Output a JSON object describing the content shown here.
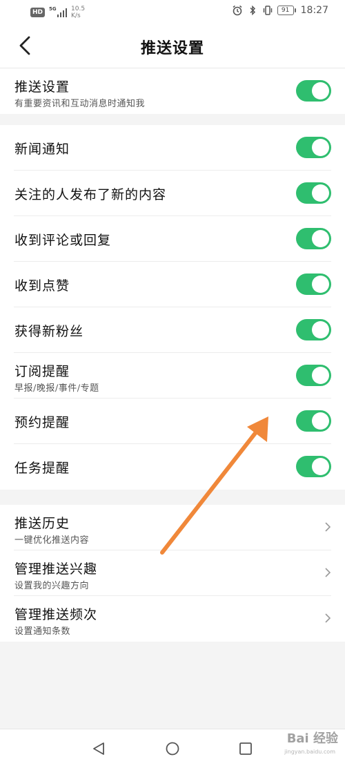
{
  "status_bar": {
    "hd_badge": "HD",
    "network": "5G",
    "net_speed_value": "10.5",
    "net_speed_unit": "K/s",
    "battery": "91",
    "time": "18:27"
  },
  "header": {
    "title": "推送设置"
  },
  "master": {
    "label": "推送设置",
    "sub": "有重要资讯和互动消息时通知我",
    "enabled": true
  },
  "notifications": [
    {
      "label": "新闻通知",
      "enabled": true
    },
    {
      "label": "关注的人发布了新的内容",
      "enabled": true
    },
    {
      "label": "收到评论或回复",
      "enabled": true
    },
    {
      "label": "收到点赞",
      "enabled": true
    },
    {
      "label": "获得新粉丝",
      "enabled": true
    },
    {
      "label": "订阅提醒",
      "sub": "早报/晚报/事件/专题",
      "enabled": true
    },
    {
      "label": "预约提醒",
      "enabled": true
    },
    {
      "label": "任务提醒",
      "enabled": true
    }
  ],
  "links": [
    {
      "label": "推送历史",
      "sub": "一键优化推送内容"
    },
    {
      "label": "管理推送兴趣",
      "sub": "设置我的兴趣方向"
    },
    {
      "label": "管理推送频次",
      "sub": "设置通知条数"
    }
  ],
  "watermark": {
    "text": "Bai 经验",
    "sub": "jingyan.baidu.com"
  },
  "colors": {
    "toggle_on": "#2fbe6f",
    "annotation_arrow": "#f0883a",
    "page_bg": "#f4f4f4"
  },
  "icons": {
    "back": "chevron-left-icon",
    "link_chevron": "chevron-right-icon",
    "nav_back": "triangle-back-icon",
    "nav_home": "circle-home-icon",
    "nav_recent": "square-recent-icon"
  }
}
